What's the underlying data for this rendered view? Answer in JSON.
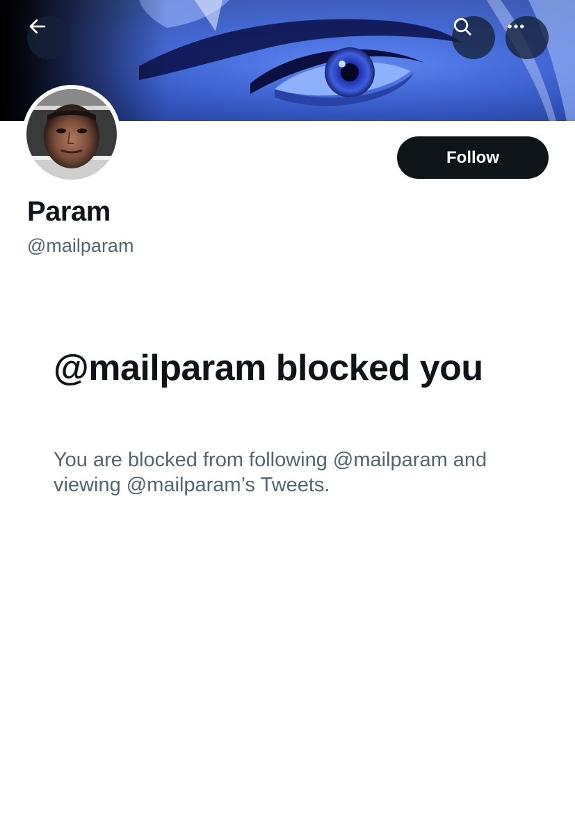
{
  "header": {
    "back_icon": "arrow-left-icon",
    "search_icon": "search-icon",
    "more_icon": "more-horizontal-icon"
  },
  "profile": {
    "display_name": "Param",
    "handle": "@mailparam",
    "follow_label": "Follow"
  },
  "blocked_notice": {
    "title": "@mailparam blocked you",
    "description": "You are blocked from following @mailparam and viewing @mailparam’s Tweets."
  },
  "colors": {
    "primary_text": "#0f1419",
    "secondary_text": "#536471",
    "follow_button_bg": "#0f1419",
    "follow_button_text": "#ffffff"
  }
}
